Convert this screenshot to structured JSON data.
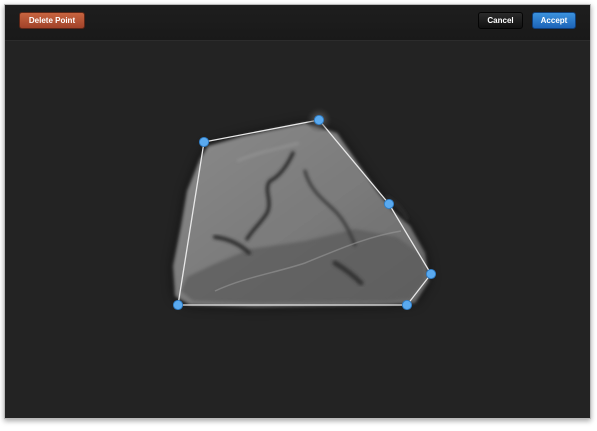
{
  "toolbar": {
    "delete_label": "Delete Point",
    "cancel_label": "Cancel",
    "accept_label": "Accept"
  },
  "colors": {
    "delete_button": "#b5533a",
    "accept_button": "#2a7fd0",
    "cancel_button": "#1b1b1b",
    "point_fill": "#5aaaf0",
    "polygon_stroke": "#e8e8e8",
    "canvas_background": "#232323"
  },
  "crop_polygon": {
    "point_count": 6
  }
}
